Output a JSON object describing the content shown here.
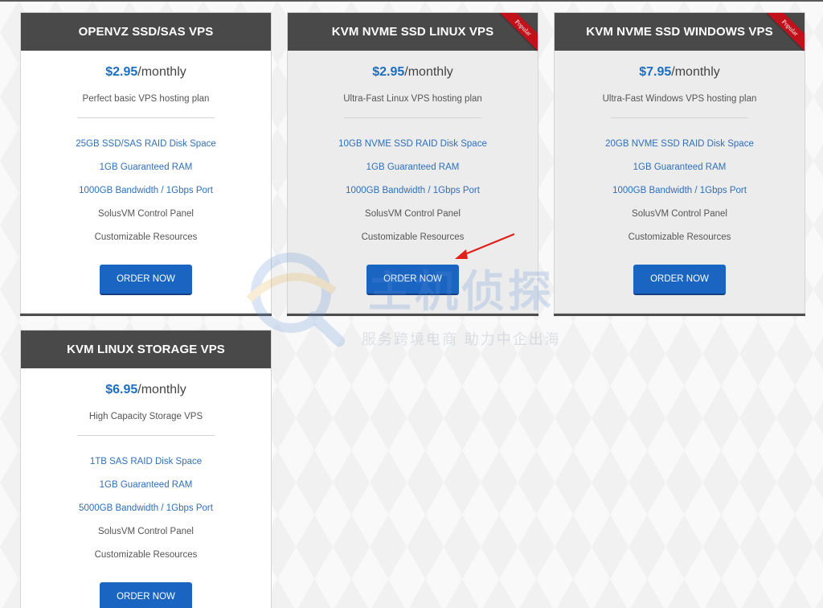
{
  "plans": [
    {
      "title": "OPENVZ SSD/SAS VPS",
      "price": "$2.95",
      "period": "/monthly",
      "description": "Perfect basic VPS hosting plan",
      "popular": false,
      "features": [
        "25GB SSD/SAS RAID Disk Space",
        "1GB Guaranteed RAM",
        "1000GB Bandwidth / 1Gbps Port",
        "SolusVM Control Panel",
        "Customizable Resources"
      ],
      "button": "ORDER NOW"
    },
    {
      "title": "KVM NVME SSD LINUX VPS",
      "price": "$2.95",
      "period": "/monthly",
      "description": "Ultra-Fast Linux VPS hosting plan",
      "popular": true,
      "ribbon": "Popular",
      "features": [
        "10GB NVME SSD RAID Disk Space",
        "1GB Guaranteed RAM",
        "1000GB Bandwidth / 1Gbps Port",
        "SolusVM Control Panel",
        "Customizable Resources"
      ],
      "button": "ORDER NOW"
    },
    {
      "title": "KVM NVME SSD WINDOWS VPS",
      "price": "$7.95",
      "period": "/monthly",
      "description": "Ultra-Fast Windows VPS hosting plan",
      "popular": true,
      "ribbon": "Popular",
      "features": [
        "20GB NVME SSD RAID Disk Space",
        "1GB Guaranteed RAM",
        "1000GB Bandwidth / 1Gbps Port",
        "SolusVM Control Panel",
        "Customizable Resources"
      ],
      "button": "ORDER NOW"
    },
    {
      "title": "KVM LINUX STORAGE VPS",
      "price": "$6.95",
      "period": "/monthly",
      "description": "High Capacity Storage VPS",
      "popular": false,
      "features": [
        "1TB SAS RAID Disk Space",
        "1GB Guaranteed RAM",
        "5000GB Bandwidth / 1Gbps Port",
        "SolusVM Control Panel",
        "Customizable Resources"
      ],
      "button": "ORDER NOW"
    }
  ],
  "watermark": {
    "brand": "主机侦探",
    "slogan": "服务跨境电商 助力中企出海"
  },
  "colors": {
    "header_bg": "#494949",
    "price_blue": "#1b6ec2",
    "feature_link": "#2f6fb8",
    "button_bg": "#1a64c2",
    "ribbon_red": "#c1121c"
  },
  "icons": {
    "annotation": "red-arrow-icon",
    "watermark_logo": "detective-logo-icon"
  }
}
